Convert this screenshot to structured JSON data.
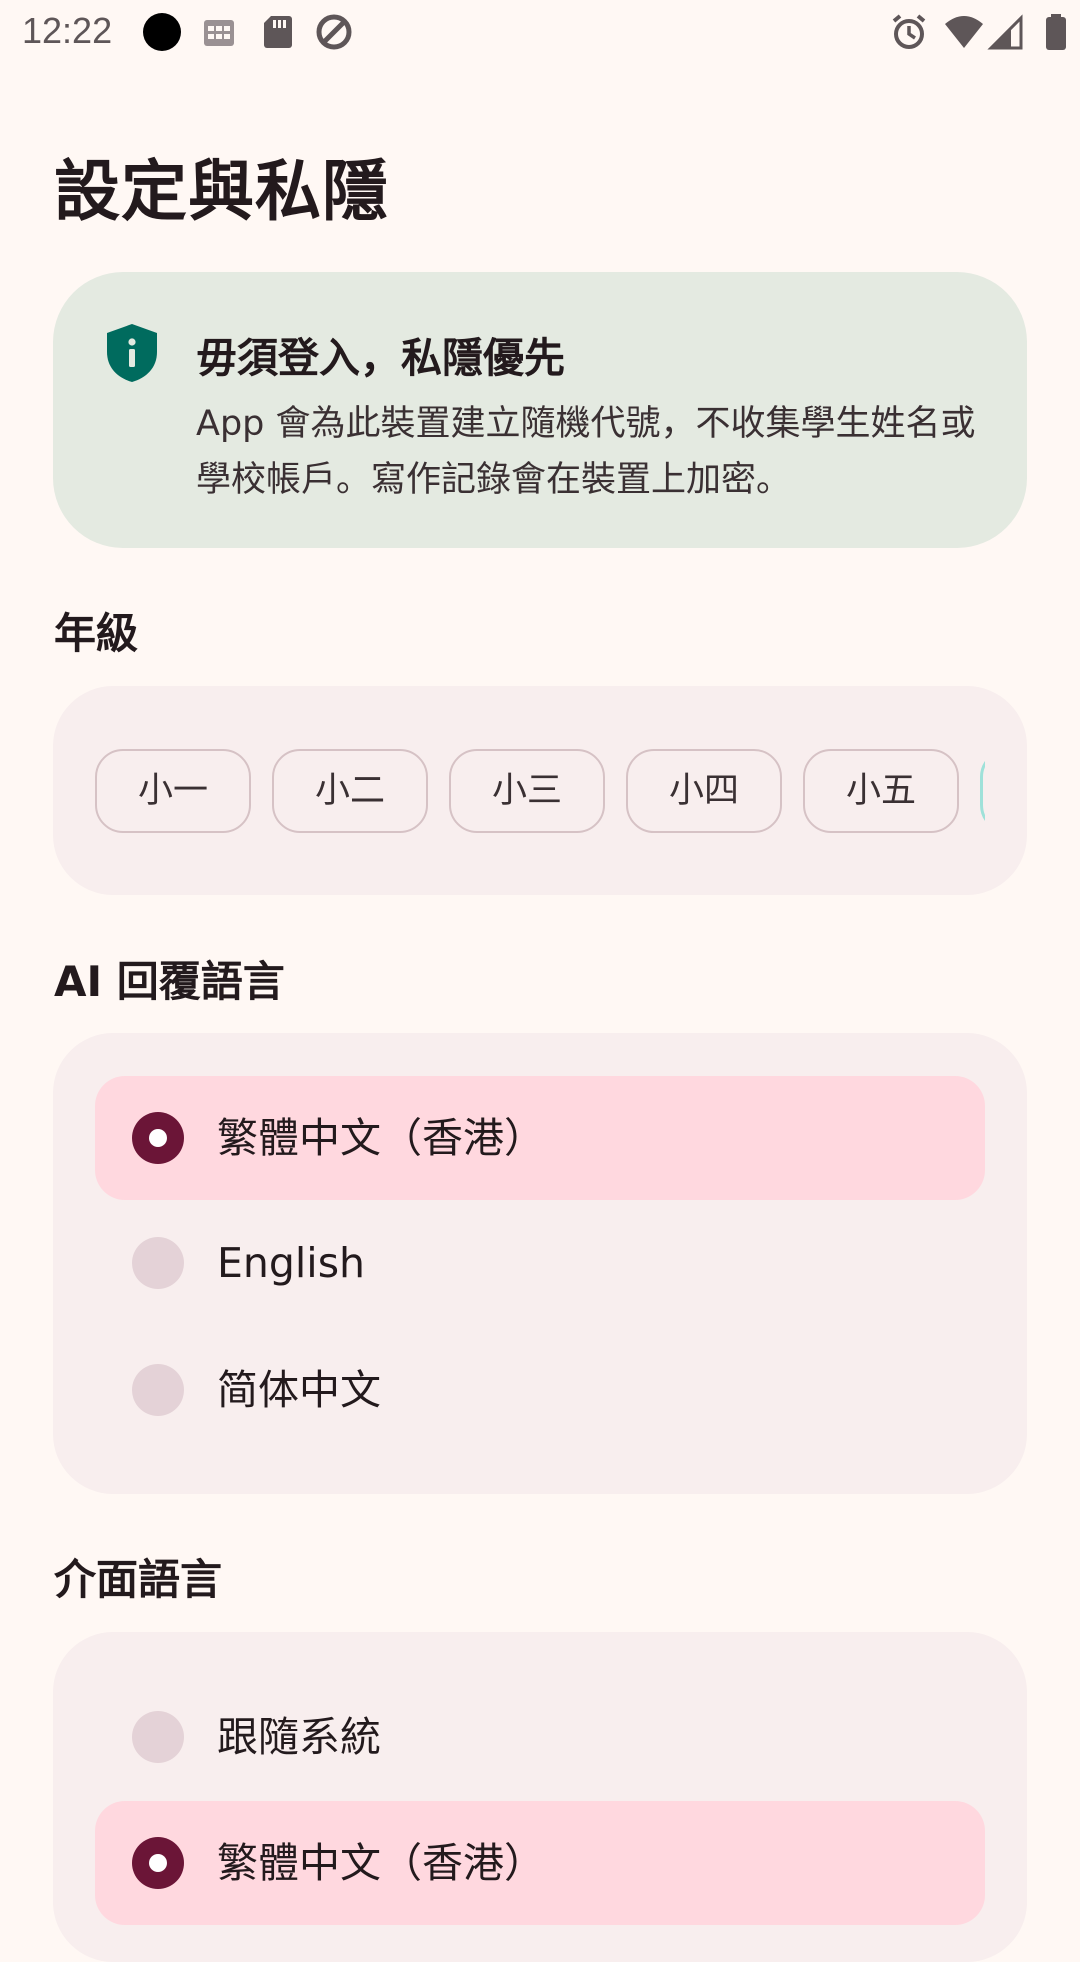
{
  "status_bar": {
    "time": "12:22"
  },
  "page": {
    "title": "設定與私隱"
  },
  "privacy_card": {
    "icon": "shield-info-icon",
    "title": "毋須登入，私隱優先",
    "body": "App 會為此裝置建立隨機代號，不收集學生姓名或學校帳戶。寫作記錄會在裝置上加密。"
  },
  "grade": {
    "heading": "年級",
    "chips": [
      "小一",
      "小二",
      "小三",
      "小四",
      "小五"
    ]
  },
  "ai_language": {
    "heading": "AI 回覆語言",
    "options": [
      {
        "label": "繁體中文（香港）",
        "selected": true
      },
      {
        "label": "English",
        "selected": false
      },
      {
        "label": "简体中文",
        "selected": false
      }
    ]
  },
  "ui_language": {
    "heading": "介面語言",
    "options": [
      {
        "label": "跟隨系統",
        "selected": false
      },
      {
        "label": "繁體中文（香港）",
        "selected": true
      }
    ]
  },
  "colors": {
    "background": "#FFF8F4",
    "privacy_card": "#E4EAE1",
    "shield": "#006B5E",
    "panel": "#F8EEEE",
    "selected_row": "#FFD8DF",
    "radio_selected": "#6B1537",
    "radio_unselected": "#E4D2D7"
  }
}
